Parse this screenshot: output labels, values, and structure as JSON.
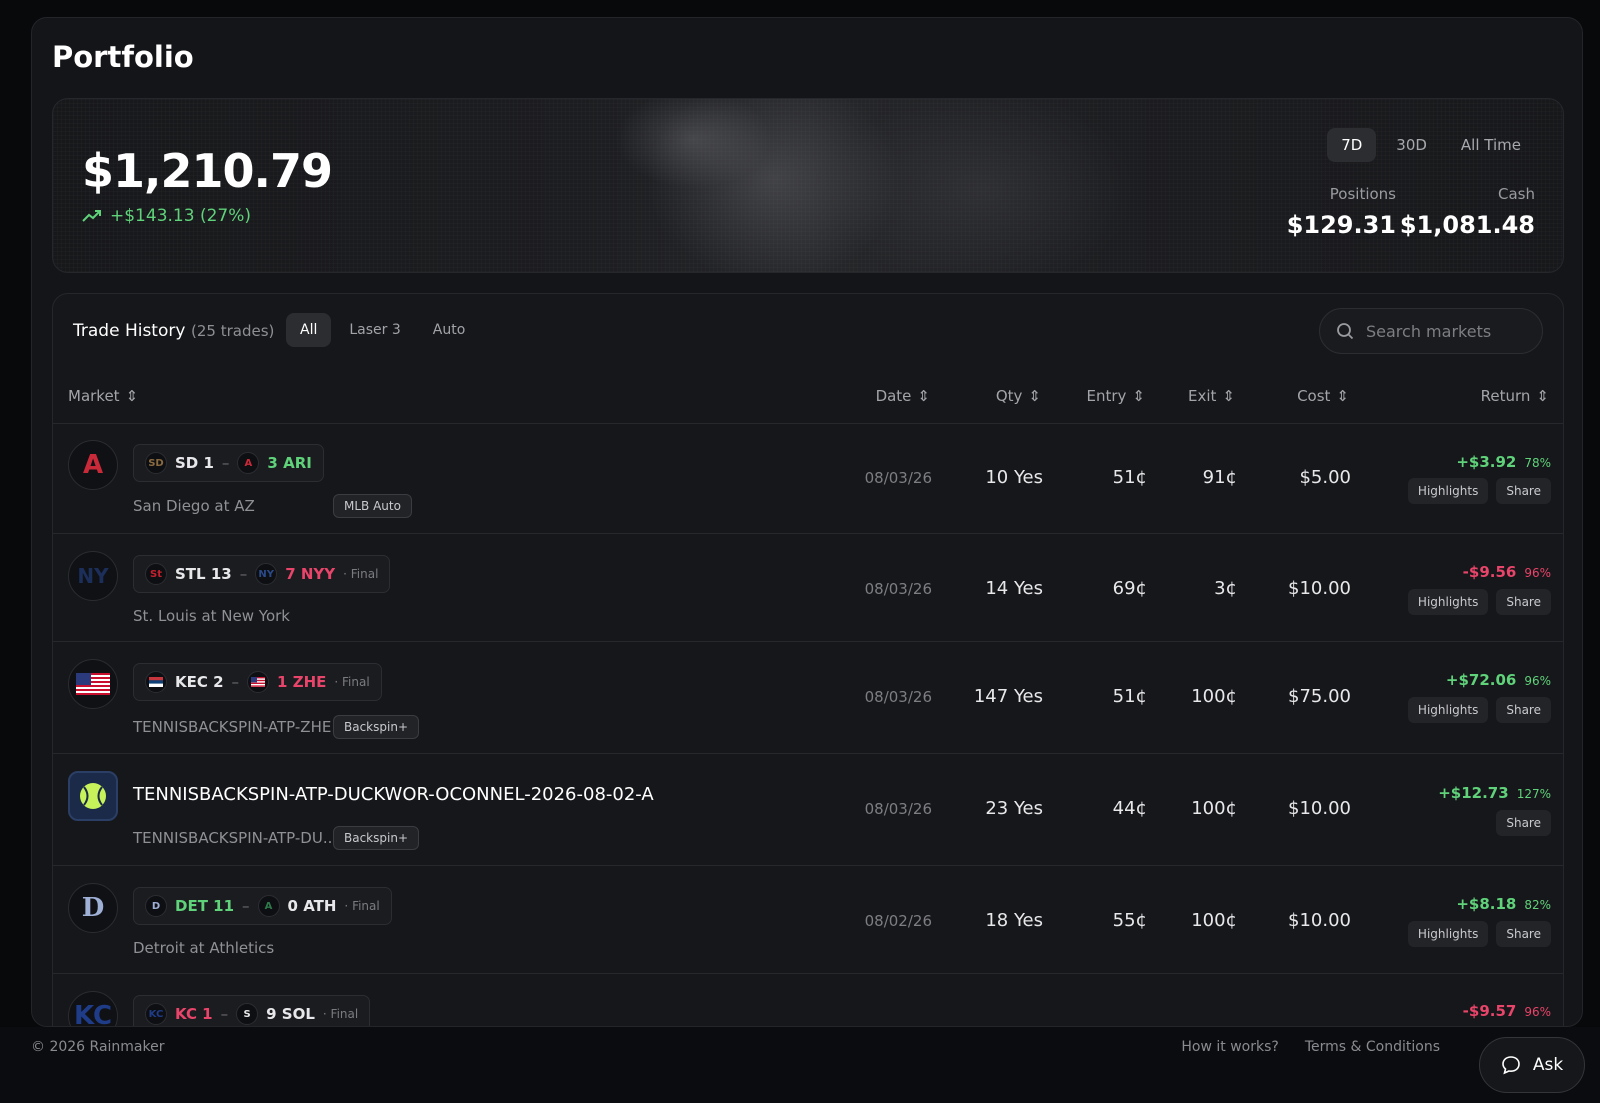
{
  "page": {
    "title": "Portfolio"
  },
  "summary": {
    "balance": "$1,210.79",
    "change": "+$143.13 (27%)",
    "ranges": [
      "7D",
      "30D",
      "All Time"
    ],
    "active_range": "7D",
    "positions_label": "Positions",
    "positions_value": "$129.31",
    "cash_label": "Cash",
    "cash_value": "$1,081.48"
  },
  "history": {
    "title": "Trade History",
    "count": "(25 trades)",
    "filters": [
      "All",
      "Laser 3",
      "Auto"
    ],
    "active_filter": "All",
    "search_placeholder": "Search markets",
    "columns": {
      "market": "Market",
      "date": "Date",
      "qty": "Qty",
      "entry": "Entry",
      "exit": "Exit",
      "cost": "Cost",
      "return": "Return"
    },
    "rows": [
      {
        "a_team": "SD 1",
        "b_team": "3 ARI",
        "status": "",
        "subtitle": "San Diego at AZ",
        "tag": "MLB Auto",
        "date": "08/03/26",
        "qty": "10 Yes",
        "entry": "51¢",
        "exit": "91¢",
        "cost": "$5.00",
        "return_amount": "+$3.92",
        "return_pct": "78%",
        "highlights_label": "Highlights",
        "share_label": "Share"
      },
      {
        "a_team": "STL 13",
        "b_team": "7 NYY",
        "status": "Final",
        "subtitle": "St. Louis at New York",
        "tag": "",
        "date": "08/03/26",
        "qty": "14 Yes",
        "entry": "69¢",
        "exit": "3¢",
        "cost": "$10.00",
        "return_amount": "-$9.56",
        "return_pct": "96%",
        "highlights_label": "Highlights",
        "share_label": "Share"
      },
      {
        "a_team": "KEC 2",
        "b_team": "1 ZHE",
        "status": "Final",
        "subtitle": "TENNISBACKSPIN-ATP-ZHE...",
        "tag": "Backspin+",
        "date": "08/03/26",
        "qty": "147 Yes",
        "entry": "51¢",
        "exit": "100¢",
        "cost": "$75.00",
        "return_amount": "+$72.06",
        "return_pct": "96%",
        "highlights_label": "Highlights",
        "share_label": "Share"
      },
      {
        "title": "TENNISBACKSPIN-ATP-DUCKWOR-OCONNEL-2026-08-02-A",
        "subtitle": "TENNISBACKSPIN-ATP-DU...",
        "tag": "Backspin+",
        "date": "08/03/26",
        "qty": "23 Yes",
        "entry": "44¢",
        "exit": "100¢",
        "cost": "$10.00",
        "return_amount": "+$12.73",
        "return_pct": "127%",
        "share_label": "Share"
      },
      {
        "a_team": "DET 11",
        "b_team": "0 ATH",
        "status": "Final",
        "subtitle": "Detroit at Athletics",
        "tag": "",
        "date": "08/02/26",
        "qty": "18 Yes",
        "entry": "55¢",
        "exit": "100¢",
        "cost": "$10.00",
        "return_amount": "+$8.18",
        "return_pct": "82%",
        "highlights_label": "Highlights",
        "share_label": "Share"
      },
      {
        "a_team": "KC 1",
        "b_team": "9 SOL",
        "status": "Final",
        "return_amount": "-$9.57",
        "return_pct": "96%"
      }
    ]
  },
  "footer": {
    "copyright": "© 2026 Rainmaker",
    "how_it_works": "How it works?",
    "terms": "Terms & Conditions",
    "ask": "Ask"
  },
  "colors": {
    "positive": "#5fd27a",
    "negative": "#e9446a",
    "accent_tennis": "#c7f25a"
  },
  "icons": [
    "trending-up-icon",
    "search-icon",
    "sort-icon",
    "chat-bubble-icon"
  ]
}
